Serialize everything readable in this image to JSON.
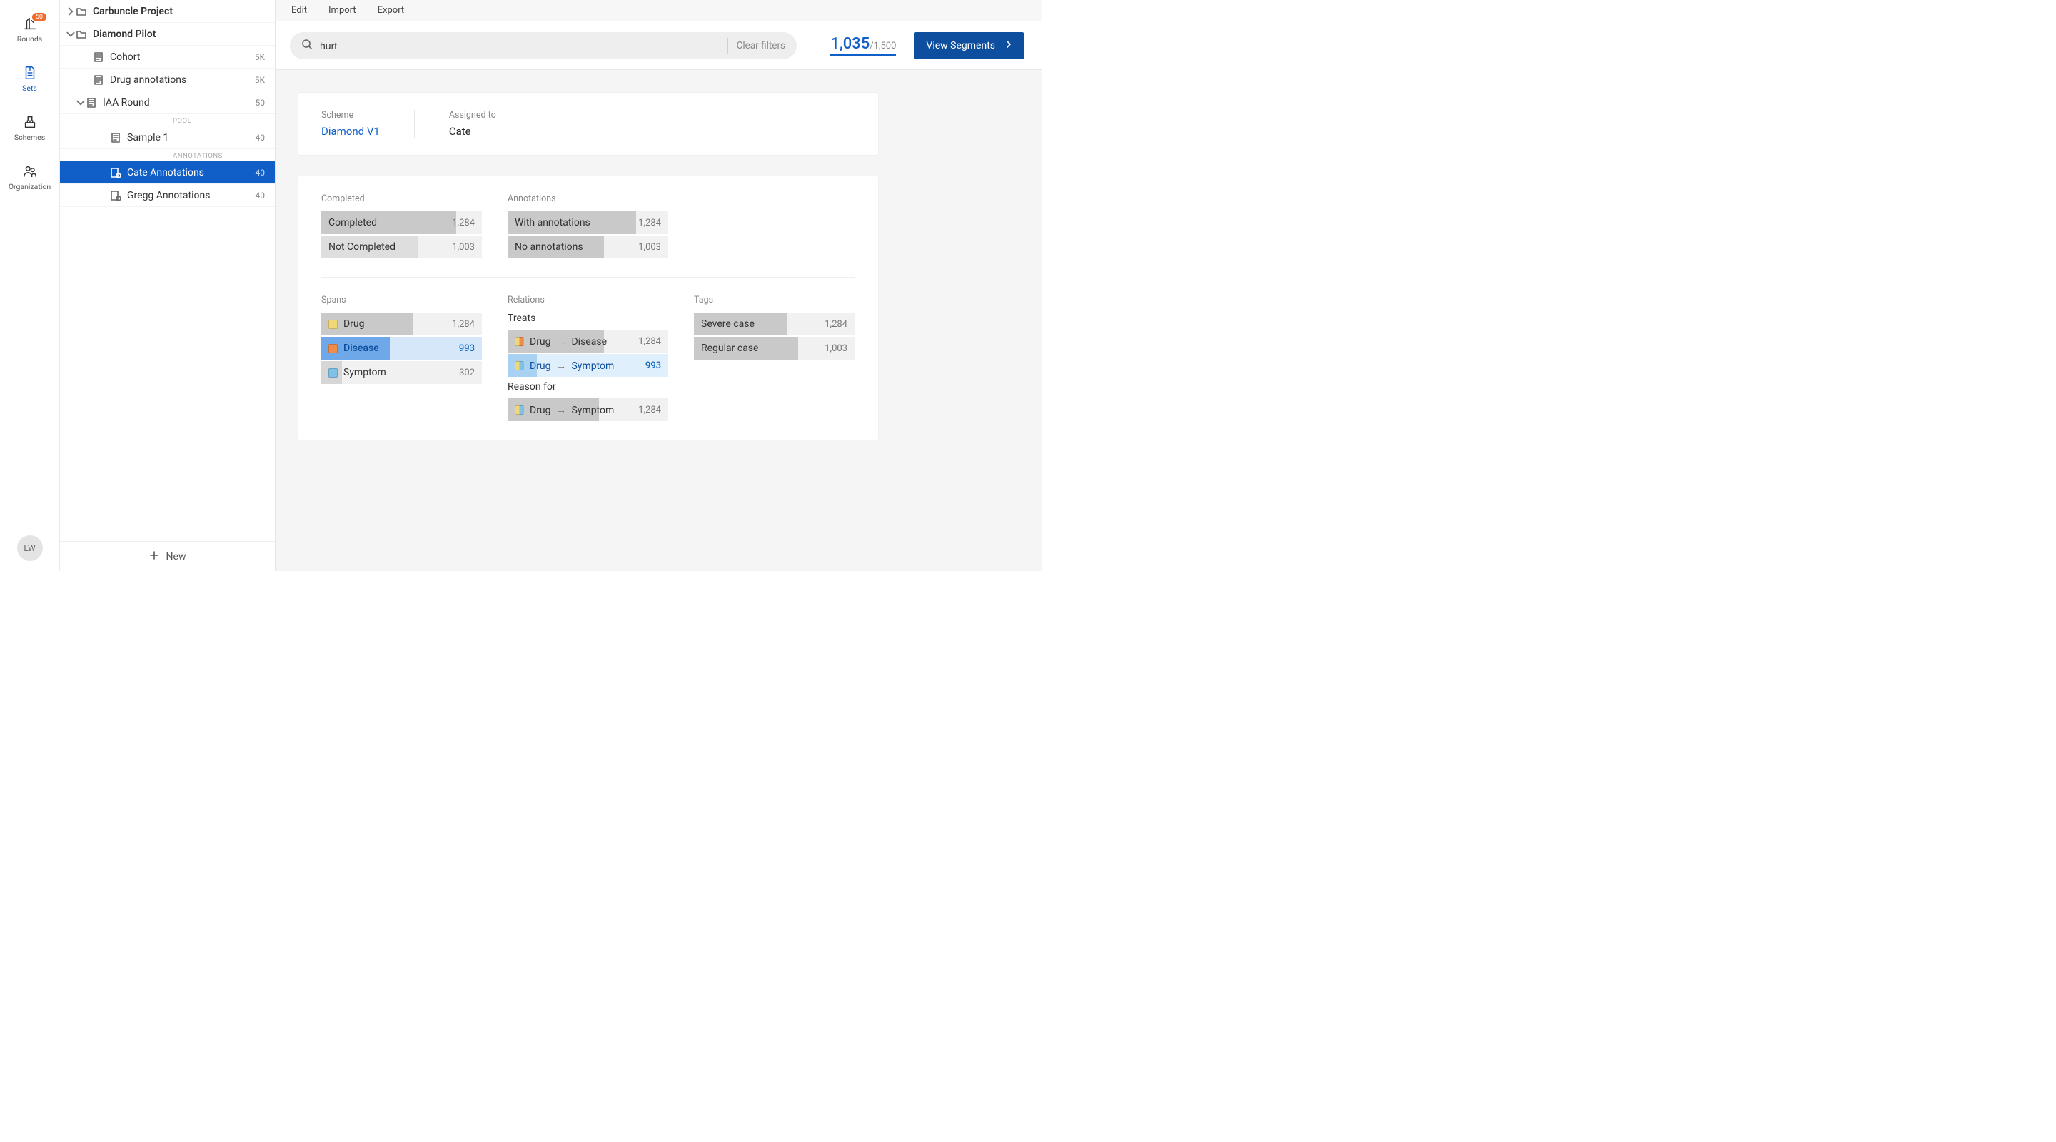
{
  "colors": {
    "accent": "#105fc8",
    "button": "#0d4f9e",
    "badge": "#f06a2b"
  },
  "rail": {
    "items": [
      {
        "label": "Rounds",
        "badge": "50"
      },
      {
        "label": "Sets"
      },
      {
        "label": "Schemes"
      },
      {
        "label": "Organization"
      }
    ],
    "avatar": "LW"
  },
  "sidebar": {
    "projects": [
      {
        "label": "Carbuncle Project"
      },
      {
        "label": "Diamond Pilot"
      }
    ],
    "tree": {
      "cohort": {
        "label": "Cohort",
        "count": "5K"
      },
      "drug_annotations": {
        "label": "Drug annotations",
        "count": "5K"
      },
      "iaa_round": {
        "label": "IAA Round",
        "count": "50"
      },
      "pool_heading": "POOL",
      "sample1": {
        "label": "Sample 1",
        "count": "40"
      },
      "annotations_heading": "ANNOTATIONS",
      "cate": {
        "label": "Cate Annotations",
        "count": "40"
      },
      "gregg": {
        "label": "Gregg Annotations",
        "count": "40"
      }
    },
    "new_button": "New"
  },
  "topbar": {
    "edit": "Edit",
    "import": "Import",
    "export": "Export"
  },
  "search": {
    "value": "hurt",
    "clear_label": "Clear filters",
    "count_main": "1,035",
    "count_total": "/1,500"
  },
  "view_segments_label": "View Segments",
  "meta": {
    "scheme_label": "Scheme",
    "scheme_value": "Diamond V1",
    "assigned_label": "Assigned to",
    "assigned_value": "Cate"
  },
  "stats": {
    "completed": {
      "header": "Completed",
      "rows": [
        {
          "label": "Completed",
          "count": "1,284",
          "fill": 84
        },
        {
          "label": "Not Completed",
          "count": "1,003",
          "fill": 60
        }
      ]
    },
    "annotations": {
      "header": "Annotations",
      "rows": [
        {
          "label": "With annotations",
          "count": "1,284",
          "fill": 80
        },
        {
          "label": "No annotations",
          "count": "1,003",
          "fill": 60
        }
      ]
    },
    "spans": {
      "header": "Spans",
      "rows": [
        {
          "label": "Drug",
          "count": "1,284",
          "fill": 57
        },
        {
          "label": "Disease",
          "count": "993",
          "fill": 43
        },
        {
          "label": "Symptom",
          "count": "302",
          "fill": 13
        }
      ]
    },
    "relations": {
      "header": "Relations",
      "treats": {
        "subheader": "Treats",
        "rows": [
          {
            "from": "Drug",
            "to": "Disease",
            "count": "1,284",
            "fill": 60
          },
          {
            "from": "Drug",
            "to": "Symptom",
            "count": "993",
            "fill": 18
          }
        ]
      },
      "reason": {
        "subheader": "Reason for",
        "rows": [
          {
            "from": "Drug",
            "to": "Symptom",
            "count": "1,284",
            "fill": 57
          }
        ]
      }
    },
    "tags": {
      "header": "Tags",
      "rows": [
        {
          "label": "Severe case",
          "count": "1,284",
          "fill": 58
        },
        {
          "label": "Regular case",
          "count": "1,003",
          "fill": 65
        }
      ]
    }
  }
}
